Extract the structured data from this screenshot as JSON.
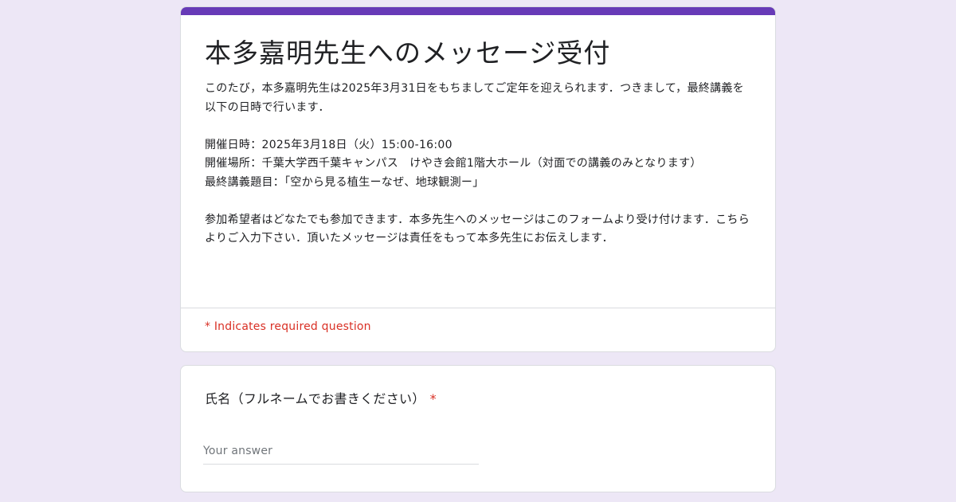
{
  "header": {
    "accent_color": "#673ab7",
    "title": "本多嘉明先生へのメッセージ受付",
    "description": [
      "このたび，本多嘉明先生は2025年3月31日をもちましてご定年を迎えられます．つきまして，最終講義を以下の日時で行います．",
      "",
      "開催日時：2025年3月18日（火）15:00-16:00",
      "開催場所：千葉大学西千葉キャンパス　けやき会館1階大ホール（対面での講義のみとなります）",
      "最終講義題目：「空から見る植生ーなぜ、地球観測ー」",
      "",
      "参加希望者はどなたでも参加できます．本多先生へのメッセージはこのフォームより受け付けます．こちらよりご入力下さい．頂いたメッセージは責任をもって本多先生にお伝えします．"
    ],
    "required_note": "* Indicates required question"
  },
  "question": {
    "label": "氏名（フルネームでお書きください）",
    "required_marker": "*",
    "placeholder": "Your answer",
    "value": ""
  },
  "colors": {
    "background": "#ede7f6",
    "required": "#d93025"
  }
}
